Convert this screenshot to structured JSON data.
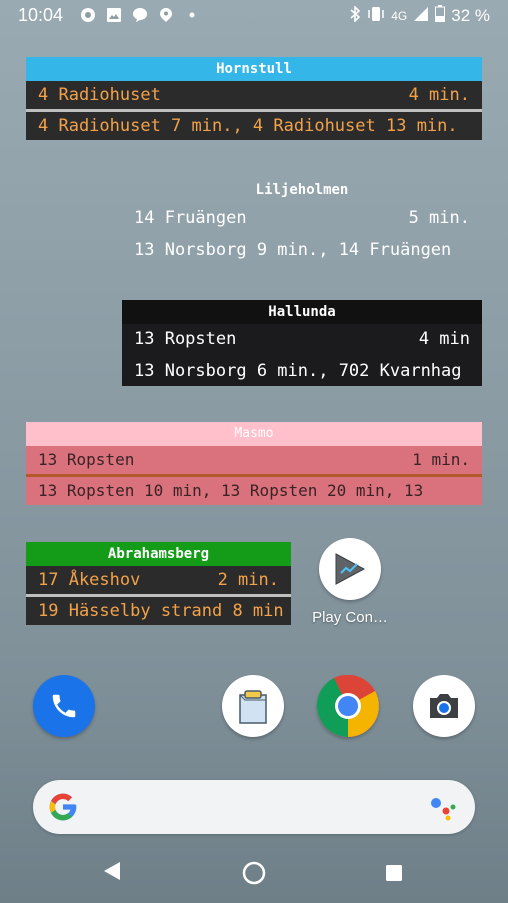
{
  "status_bar": {
    "time": "10:04",
    "network": "4G",
    "battery": "32 %",
    "left_icons": [
      "sync-icon",
      "image-icon",
      "chat-bubble-icon",
      "location-pin-icon",
      "dot-icon"
    ],
    "right_icons": [
      "bluetooth-icon",
      "vibrate-icon",
      "signal-icon",
      "battery-icon"
    ]
  },
  "widgets": [
    {
      "title": "Hornstull",
      "color": "#35b6e8",
      "rows": [
        {
          "left": "4 Radiohuset",
          "right": "4 min."
        },
        {
          "left": "4 Radiohuset 7 min.,  4 Radiohuset 13 min.",
          "right": ""
        }
      ]
    },
    {
      "title": "Liljeholmen",
      "color": "transparent",
      "rows": [
        {
          "left": "14 Fruängen",
          "right": "5 min."
        },
        {
          "left": "13 Norsborg 9 min.,  14 Fruängen",
          "right": ""
        }
      ]
    },
    {
      "title": "Hallunda",
      "color": "#111111",
      "rows": [
        {
          "left": "13 Ropsten",
          "right": "4 min"
        },
        {
          "left": "13 Norsborg 6 min.,  702 Kvarnhag",
          "right": ""
        }
      ]
    },
    {
      "title": "Masmo",
      "color": "#ffbfcb",
      "rows": [
        {
          "left": "13 Ropsten",
          "right": "1 min."
        },
        {
          "left": "13 Ropsten 10 min,  13 Ropsten 20 min,  13",
          "right": ""
        }
      ]
    },
    {
      "title": "Abrahamsberg",
      "color": "#149b18",
      "rows": [
        {
          "left": "17 Åkeshov",
          "right": "2 min."
        },
        {
          "left": "19 Hässelby strand 8 min",
          "right": ""
        }
      ]
    }
  ],
  "apps": {
    "play_console": {
      "label": "Play Con…",
      "icon": "play-console-icon"
    }
  },
  "dock": [
    {
      "name": "phone",
      "icon": "phone-icon"
    },
    {
      "name": "clipboard",
      "icon": "clipboard-icon"
    },
    {
      "name": "chrome",
      "icon": "chrome-icon"
    },
    {
      "name": "camera",
      "icon": "camera-icon"
    }
  ],
  "search_bar": {
    "icon": "google-logo-icon",
    "assistant_icon": "google-assistant-icon"
  },
  "nav_bar": {
    "buttons": [
      "back-icon",
      "home-icon",
      "recents-icon"
    ]
  }
}
